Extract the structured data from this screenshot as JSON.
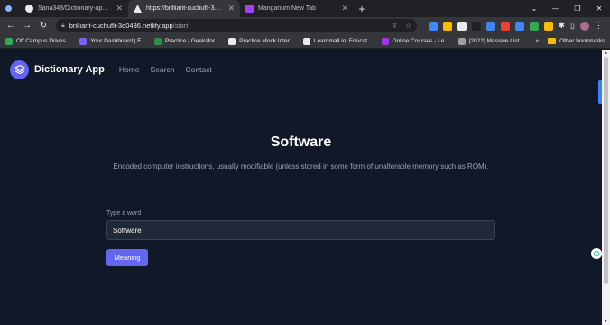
{
  "browser": {
    "tabs": [
      {
        "title": "Sana348/Dictionary-app: Dictio...",
        "favicon_color": "#e8eaed"
      },
      {
        "title": "https://brilliant-cuchufli-3d0436...",
        "favicon_color": "#e8eaed"
      },
      {
        "title": "Manganum New Tab",
        "favicon_color": "#a142f4"
      }
    ],
    "new_tab_glyph": "+",
    "url_host": "brilliant-cuchufli-3d0436.netlify.app",
    "url_path": "/start",
    "bookmarks": [
      {
        "label": "Off Campus Drives...",
        "color": "#34a853"
      },
      {
        "label": "Your Dashboard | F...",
        "color": "#7b61ff"
      },
      {
        "label": "Practice | Geeksfor...",
        "color": "#2f8d46"
      },
      {
        "label": "Practice Mock Inter...",
        "color": "#e8eaed"
      },
      {
        "label": "Learnmall.in: Educat...",
        "color": "#e8eaed"
      },
      {
        "label": "Online Courses - Le...",
        "color": "#a435f0"
      },
      {
        "label": "[2022] Massive List...",
        "color": "#9aa0a6"
      }
    ],
    "bookmarks_more": "»",
    "other_bookmarks": "Other bookmarks",
    "extension_colors": [
      "#4285f4",
      "#fbbc04",
      "#e8eaed",
      "#202124",
      "#4285f4",
      "#ea4335",
      "#4285f4",
      "#34a853",
      "#fbbc04"
    ]
  },
  "app": {
    "brand": "Dictionary App",
    "nav": [
      "Home",
      "Search",
      "Contact"
    ],
    "word": "Software",
    "definition": "Encoded computer instructions, usually modifiable (unless stored in some form of unalterable memory such as ROM).",
    "input_label": "Type a word",
    "input_value": "Software",
    "button_label": "Meaning",
    "accent": "#6366f1"
  }
}
